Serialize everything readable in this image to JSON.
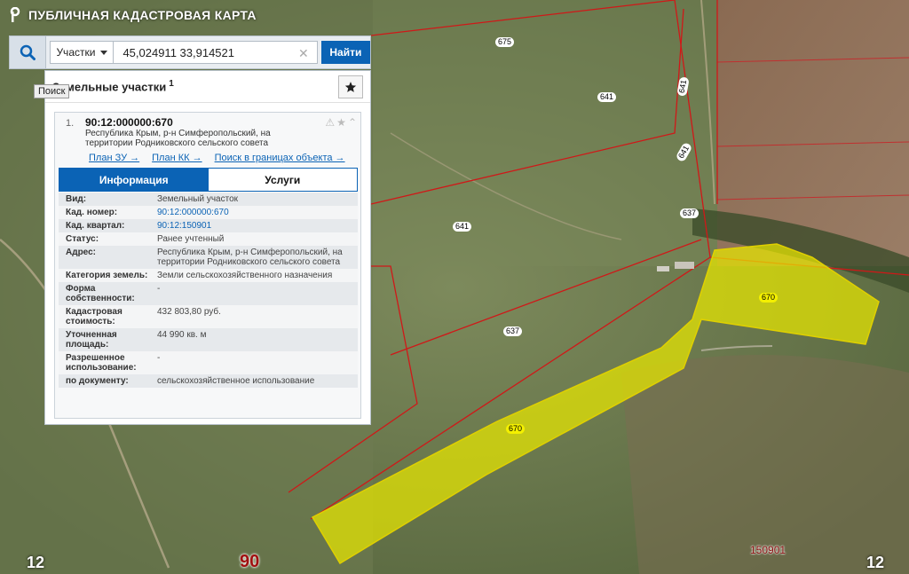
{
  "app": {
    "title": "ПУБЛИЧНАЯ КАДАСТРОВАЯ КАРТА"
  },
  "search": {
    "type_label": "Участки",
    "query": "45,024911 33,914521",
    "find_label": "Найти",
    "tooltip": "Поиск"
  },
  "results": {
    "title": "Земельные участки",
    "count": "1",
    "item": {
      "index": "1.",
      "cad_number": "90:12:000000:670",
      "address": "Республика Крым, р-н Симферопольский, на территории Родниковского сельского совета",
      "links": [
        "План ЗУ →",
        "План КК →",
        "Поиск в границах объекта →"
      ],
      "tabs": [
        "Информация",
        "Услуги"
      ],
      "fields": [
        {
          "key": "Вид:",
          "value": "Земельный участок"
        },
        {
          "key": "Кад. номер:",
          "value": "90:12:000000:670"
        },
        {
          "key": "Кад. квартал:",
          "value": "90:12:150901"
        },
        {
          "key": "Статус:",
          "value": "Ранее учтенный"
        },
        {
          "key": "Адрес:",
          "value": "Республика Крым, р-н Симферопольский, на территории Родниковского сельского совета"
        },
        {
          "key": "Категория земель:",
          "value": "Земли сельскохозяйственного назначения"
        },
        {
          "key": "Форма собственности:",
          "value": "-"
        },
        {
          "key": "Кадастровая стоимость:",
          "value": "432 803,80 руб."
        },
        {
          "key": "Уточненная площадь:",
          "value": "44 990 кв. м"
        },
        {
          "key": "Разрешенное использование:",
          "value": "-"
        },
        {
          "key": "по документу:",
          "value": "сельскохозяйственное использование"
        }
      ]
    }
  },
  "map": {
    "parcel_labels": [
      "675",
      "641",
      "641",
      "641",
      "637",
      "641",
      "637",
      "670",
      "670"
    ],
    "grid_labels": [
      "12",
      "90",
      "150901",
      "12"
    ],
    "colors": {
      "highlight_fill": "#e8e800",
      "boundary": "#d01818",
      "accent": "#0b63b5"
    }
  }
}
